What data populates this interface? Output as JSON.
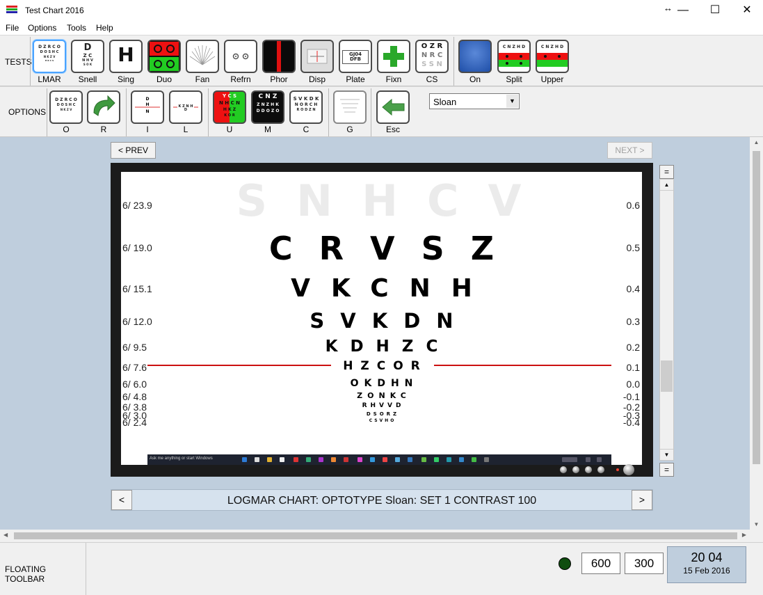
{
  "window": {
    "title": "Test Chart 2016",
    "minimize_glyph": "—",
    "maximize_glyph": "☐",
    "close_glyph": "✕",
    "resize_glyph": "↔"
  },
  "menu": [
    "File",
    "Options",
    "Tools",
    "Help"
  ],
  "tests_row": {
    "label": "TESTS",
    "buttons": [
      "LMAR",
      "Snell",
      "Sing",
      "Duo",
      "Fan",
      "Refrn",
      "Phor",
      "Disp",
      "Plate",
      "Fixn",
      "CS",
      "On",
      "Split",
      "Upper"
    ]
  },
  "options_row": {
    "label": "OPTIONS",
    "buttons": [
      "O",
      "R",
      "I",
      "L",
      "U",
      "M",
      "C",
      "G",
      "Esc"
    ]
  },
  "icon_text": {
    "lmar": [
      "D Z R C O",
      "D O S H C",
      "N K Z V",
      "H K C S"
    ],
    "snell_big": "D",
    "snell_rows": [
      "Z C",
      "N H V",
      "S O K"
    ],
    "sing": "H",
    "plate": "GJ04 DFB",
    "cs": [
      "O Z R",
      "N R C",
      "S S N"
    ],
    "split_top": "C N Z H D",
    "upper_top": "C N Z H D",
    "opt_o": [
      "D Z R C O",
      "D O S H C",
      "N K Z V"
    ],
    "opt_i_letters": "D H N",
    "opt_l_letters": "K Z N H D",
    "opt_u": [
      "Y C S",
      "N H C N",
      "H K Z",
      "K O R"
    ],
    "opt_m": [
      "C N Z",
      "Z N Z H K",
      "D D O Z O"
    ],
    "opt_c": [
      "S V K D K",
      "N O R C H",
      "R O D Z N"
    ]
  },
  "dropdown": {
    "value": "Sloan",
    "arrow": "▼"
  },
  "nav": {
    "prev": "< PREV",
    "next": "NEXT >"
  },
  "chart": {
    "ghost_row": "SNHCV",
    "rows": [
      {
        "snellen": "6/ 23.9",
        "logmar": "0.6"
      },
      {
        "snellen": "6/ 19.0",
        "logmar": "0.5",
        "letters": "CRVSZ"
      },
      {
        "snellen": "6/ 15.1",
        "logmar": "0.4",
        "letters": "VKCNH"
      },
      {
        "snellen": "6/ 12.0",
        "logmar": "0.3",
        "letters": "SVKDN"
      },
      {
        "snellen": "6/ 9.5",
        "logmar": "0.2",
        "letters": "KDHZC"
      },
      {
        "snellen": "6/ 7.6",
        "logmar": "0.1",
        "letters": "HZCOR"
      },
      {
        "snellen": "6/ 6.0",
        "logmar": "0.0",
        "letters": "OKDHN"
      },
      {
        "snellen": "6/ 4.8",
        "logmar": "-0.1",
        "letters": "ZONKC"
      },
      {
        "snellen": "6/ 3.8",
        "logmar": "-0.2",
        "letters": "RHVVD"
      },
      {
        "snellen": "6/ 3.0",
        "logmar": "-0.3",
        "letters": "DSORZ"
      },
      {
        "snellen": "6/ 2.4",
        "logmar": "-0.4",
        "letters": "CSVHO"
      }
    ],
    "taskbar_text": "Ask me anything or start Windows"
  },
  "side_controls": {
    "eq_glyph": "=",
    "up_glyph": "▲",
    "down_glyph": "▼"
  },
  "caption": {
    "text": "LOGMAR CHART:  OPTOTYPE Sloan:   SET 1  CONTRAST  100",
    "left_arrow": "<",
    "right_arrow": ">"
  },
  "scroll_glyphs": {
    "up": "▲",
    "down": "▼",
    "left": "◀",
    "right": "▶"
  },
  "bottom": {
    "floating_toolbar_label": "FLOATING TOOLBAR",
    "value_1": "600",
    "value_2": "300",
    "clock_time": "20 04",
    "clock_date": "15 Feb 2016",
    "status_color": "#0f4d0f"
  }
}
